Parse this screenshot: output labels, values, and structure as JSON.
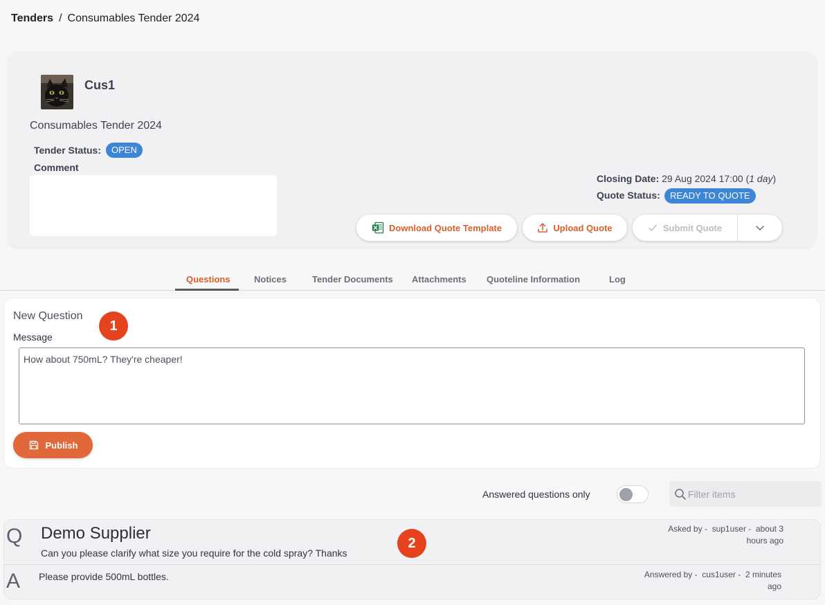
{
  "breadcrumb": {
    "root": "Tenders",
    "separator": "/",
    "current": "Consumables Tender 2024"
  },
  "header": {
    "org_name": "Cus1",
    "tender_title": "Consumables Tender 2024",
    "tender_status_label": "Tender Status:",
    "tender_status": "OPEN",
    "comment_label": "Comment",
    "comment_value": "",
    "closing_date_label": "Closing Date:",
    "closing_date": "29 Aug 2024 17:00",
    "closing_remaining": "1 day",
    "quote_status_label": "Quote Status:",
    "quote_status": "READY TO QUOTE",
    "buttons": {
      "download": "Download Quote Template",
      "upload": "Upload Quote",
      "submit": "Submit Quote"
    }
  },
  "tabs": [
    {
      "label": "Questions",
      "active": true
    },
    {
      "label": "Notices",
      "active": false
    },
    {
      "label": "Tender Documents",
      "active": false
    },
    {
      "label": "Attachments",
      "active": false
    },
    {
      "label": "Quoteline Information",
      "active": false
    },
    {
      "label": "Log",
      "active": false
    }
  ],
  "new_question": {
    "title": "New Question",
    "message_label": "Message",
    "message_value": "How about 750mL? They're cheaper!",
    "publish_label": "Publish"
  },
  "annotations": {
    "one": "1",
    "two": "2"
  },
  "filters": {
    "answered_only_label": "Answered questions only",
    "answered_only": false,
    "filter_placeholder": "Filter items"
  },
  "qa": {
    "q_letter": "Q",
    "a_letter": "A",
    "supplier": "Demo Supplier",
    "question": "Can you please clarify what size you require for the cold spray? Thanks",
    "asked_by_label": "Asked by -",
    "asked_by": "sup1user -",
    "asked_when": "about 3 hours ago",
    "answer": "Please provide 500mL bottles.",
    "answered_by_label": "Answered by -",
    "answered_by": "cus1user -",
    "answered_when": "2 minutes ago"
  },
  "colors": {
    "accent": "#d85f2c",
    "badge": "#3d86d6",
    "annotation": "#e5431e"
  }
}
